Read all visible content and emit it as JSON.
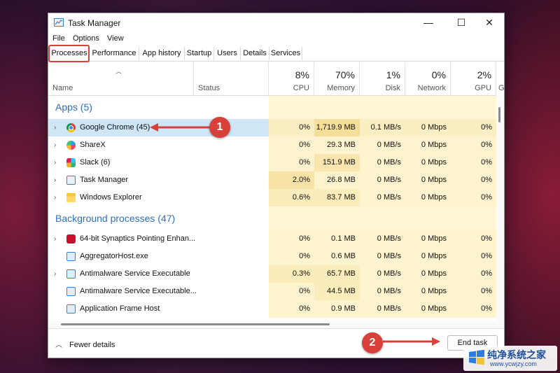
{
  "window": {
    "title": "Task Manager",
    "controls": {
      "minimize": "—",
      "maximize": "☐",
      "close": "✕"
    }
  },
  "menu": [
    "File",
    "Options",
    "View"
  ],
  "tabs": [
    "Processes",
    "Performance",
    "App history",
    "Startup",
    "Users",
    "Details",
    "Services"
  ],
  "columns": {
    "name": "Name",
    "status": "Status",
    "cpu": {
      "pct": "8%",
      "label": "CPU"
    },
    "memory": {
      "pct": "70%",
      "label": "Memory"
    },
    "disk": {
      "pct": "1%",
      "label": "Disk"
    },
    "network": {
      "pct": "0%",
      "label": "Network"
    },
    "gpu": {
      "pct": "2%",
      "label": "GPU"
    },
    "extra": "G"
  },
  "groups": {
    "apps": "Apps (5)",
    "background": "Background processes (47)"
  },
  "apps": [
    {
      "name": "Google Chrome (45)",
      "cpu": "0%",
      "memory": "1,719.9 MB",
      "disk": "0.1 MB/s",
      "network": "0 Mbps",
      "gpu": "0%",
      "icon": "chrome-icon"
    },
    {
      "name": "ShareX",
      "cpu": "0%",
      "memory": "29.3 MB",
      "disk": "0 MB/s",
      "network": "0 Mbps",
      "gpu": "0%",
      "icon": "sharex-icon"
    },
    {
      "name": "Slack (6)",
      "cpu": "0%",
      "memory": "151.9 MB",
      "disk": "0 MB/s",
      "network": "0 Mbps",
      "gpu": "0%",
      "icon": "slack-icon"
    },
    {
      "name": "Task Manager",
      "cpu": "2.0%",
      "memory": "26.8 MB",
      "disk": "0 MB/s",
      "network": "0 Mbps",
      "gpu": "0%",
      "icon": "task-manager-icon"
    },
    {
      "name": "Windows Explorer",
      "cpu": "0.6%",
      "memory": "83.7 MB",
      "disk": "0 MB/s",
      "network": "0 Mbps",
      "gpu": "0%",
      "icon": "folder-icon"
    }
  ],
  "background": [
    {
      "name": "64-bit Synaptics Pointing Enhan...",
      "cpu": "0%",
      "memory": "0.1 MB",
      "disk": "0 MB/s",
      "network": "0 Mbps",
      "gpu": "0%",
      "icon": "synaptics-icon"
    },
    {
      "name": "AggregatorHost.exe",
      "cpu": "0%",
      "memory": "0.6 MB",
      "disk": "0 MB/s",
      "network": "0 Mbps",
      "gpu": "0%",
      "icon": "process-icon"
    },
    {
      "name": "Antimalware Service Executable",
      "cpu": "0.3%",
      "memory": "65.7 MB",
      "disk": "0 MB/s",
      "network": "0 Mbps",
      "gpu": "0%",
      "icon": "process-icon"
    },
    {
      "name": "Antimalware Service Executable...",
      "cpu": "0%",
      "memory": "44.5 MB",
      "disk": "0 MB/s",
      "network": "0 Mbps",
      "gpu": "0%",
      "icon": "process-icon"
    },
    {
      "name": "Application Frame Host",
      "cpu": "0%",
      "memory": "0.9 MB",
      "disk": "0 MB/s",
      "network": "0 Mbps",
      "gpu": "0%",
      "icon": "process-icon"
    }
  ],
  "footer": {
    "fewer_details": "Fewer details",
    "end_task": "End task"
  },
  "callouts": [
    "1",
    "2"
  ],
  "watermark": {
    "title": "纯净系统之家",
    "url": "www.ycwjzy.com"
  },
  "colors": {
    "accent": "#2f6fbd",
    "callout": "#d8403a",
    "heat_light": "#fff6d6",
    "heat_mid": "#fdefc0",
    "heat_strong": "#f9e3a0",
    "selected_row": "#cfe6f6"
  }
}
